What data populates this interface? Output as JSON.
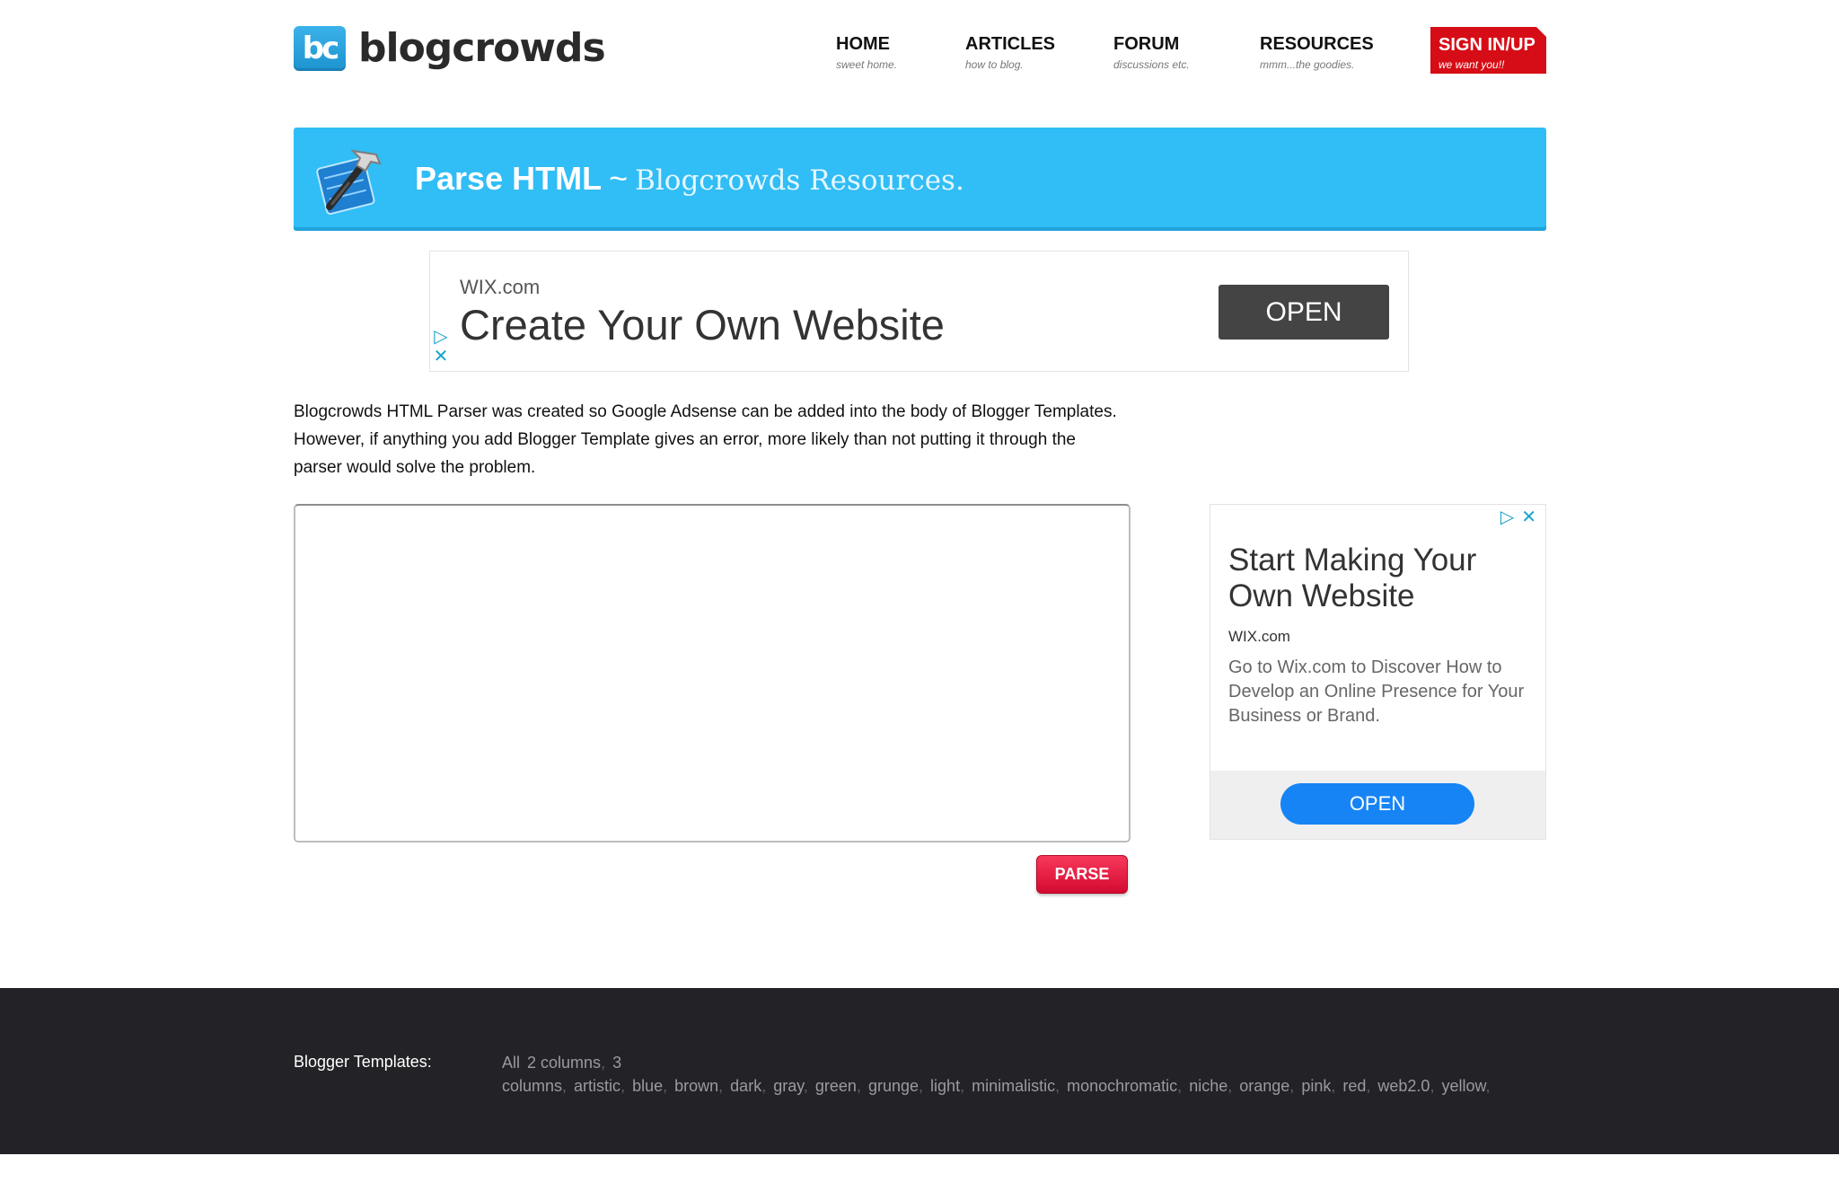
{
  "logo": {
    "badge": "bc",
    "text": "blogcrowds"
  },
  "nav": [
    {
      "title": "HOME",
      "subtitle": "sweet home."
    },
    {
      "title": "ARTICLES",
      "subtitle": "how to blog."
    },
    {
      "title": "FORUM",
      "subtitle": "discussions etc."
    },
    {
      "title": "RESOURCES",
      "subtitle": "mmm...the goodies."
    },
    {
      "title": "SIGN IN/UP",
      "subtitle": "we want you!!"
    }
  ],
  "banner": {
    "title": "Parse HTML",
    "separator": "~",
    "subtitle": "Blogcrowds Resources."
  },
  "ad_top": {
    "source": "WIX.com",
    "headline": "Create Your Own Website",
    "button": "OPEN"
  },
  "description": "Blogcrowds HTML Parser was created so Google Adsense can be added into the body of Blogger Templates. However, if anything you add Blogger Template gives an error, more likely than not putting it through the parser would solve the problem.",
  "parser": {
    "input_value": "",
    "button": "PARSE"
  },
  "ad_side": {
    "headline": "Start Making Your Own Website",
    "source": "WIX.com",
    "body": "Go to Wix.com to Discover How to Develop an Online Presence for Your Business or Brand.",
    "button": "OPEN"
  },
  "footer": {
    "label": "Blogger Templates:",
    "tags": [
      "All",
      "2 columns",
      "3 columns",
      "artistic",
      "blue",
      "brown",
      "dark",
      "gray",
      "green",
      "grunge",
      "light",
      "minimalistic",
      "monochromatic",
      "niche",
      "orange",
      "pink",
      "red",
      "web2.0",
      "yellow"
    ]
  },
  "colors": {
    "banner": "#31bdf5",
    "signup": "#d60d16",
    "parse_button": "#e81b44",
    "side_ad_button": "#1684f5",
    "footer": "#232226"
  },
  "icons": {
    "banner": "hammer-tool-icon",
    "ad_choices": "ad-choices-icon",
    "ad_close": "close-icon"
  }
}
